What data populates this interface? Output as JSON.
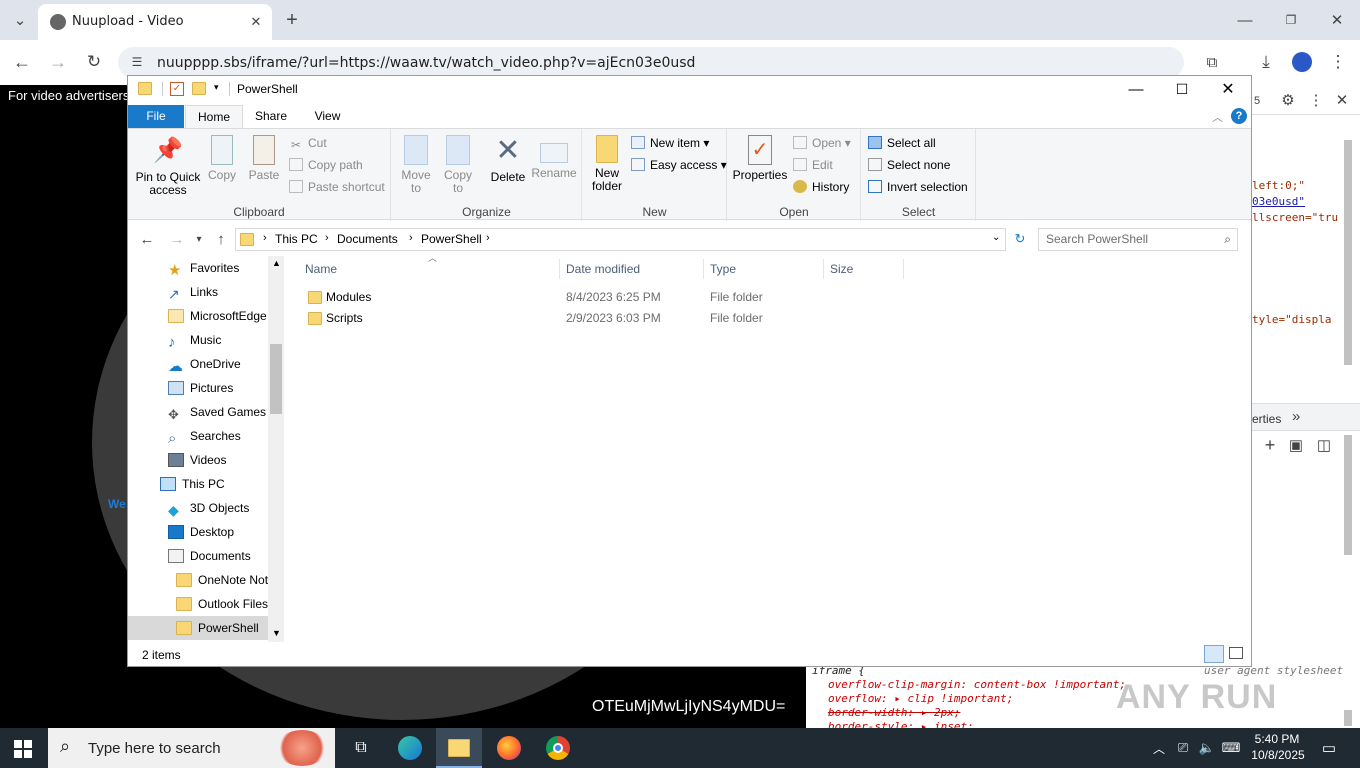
{
  "browser": {
    "tab_title": "Nuupload - Video",
    "url": "nuupppp.sbs/iframe/?url=https://waaw.tv/watch_video.php?v=ajEcn03e0usd"
  },
  "page": {
    "advert_text": "For video advertisers",
    "encoded_text": "OTEuMjMwLjIyNS4yMDU=",
    "partial_text": "We"
  },
  "devtools": {
    "code_lines": [
      "left:0;\"",
      "03e0usd\"",
      "llscreen=\"tru",
      "tyle=\"displa"
    ],
    "tab_fragment": "5",
    "properties_label": "erties",
    "css_lines": [
      "iframe {",
      "overflow-clip-margin: content-box !important;",
      "overflow: ▸ clip !important;",
      "border-width: ▸ 2px;",
      "border-style: ▸ inset;"
    ],
    "ua_label": "user agent stylesheet"
  },
  "explorer": {
    "title": "PowerShell",
    "ribbon_tabs": [
      "File",
      "Home",
      "Share",
      "View"
    ],
    "clipboard": {
      "pin": "Pin to Quick access",
      "copy": "Copy",
      "paste": "Paste",
      "cut": "Cut",
      "copy_path": "Copy path",
      "paste_shortcut": "Paste shortcut",
      "label": "Clipboard"
    },
    "organize": {
      "move": "Move to",
      "copy": "Copy to",
      "delete": "Delete",
      "rename": "Rename",
      "label": "Organize"
    },
    "new": {
      "new_folder": "New folder",
      "new_item": "New item",
      "easy_access": "Easy access",
      "label": "New"
    },
    "open": {
      "properties": "Properties",
      "open": "Open",
      "edit": "Edit",
      "history": "History",
      "label": "Open"
    },
    "select": {
      "all": "Select all",
      "none": "Select none",
      "invert": "Invert selection",
      "label": "Select"
    },
    "breadcrumb": [
      "This PC",
      "Documents",
      "PowerShell"
    ],
    "search_placeholder": "Search PowerShell",
    "nav": [
      "Favorites",
      "Links",
      "MicrosoftEdge",
      "Music",
      "OneDrive",
      "Pictures",
      "Saved Games",
      "Searches",
      "Videos",
      "This PC",
      "3D Objects",
      "Desktop",
      "Documents",
      "OneNote Not",
      "Outlook Files",
      "PowerShell"
    ],
    "columns": [
      "Name",
      "Date modified",
      "Type",
      "Size"
    ],
    "files": [
      {
        "name": "Modules",
        "date": "8/4/2023 6:25 PM",
        "type": "File folder"
      },
      {
        "name": "Scripts",
        "date": "2/9/2023 6:03 PM",
        "type": "File folder"
      }
    ],
    "status": "2 items"
  },
  "taskbar": {
    "search_placeholder": "Type here to search",
    "time": "5:40 PM",
    "date": "10/8/2025"
  },
  "watermark": "ANY RUN"
}
